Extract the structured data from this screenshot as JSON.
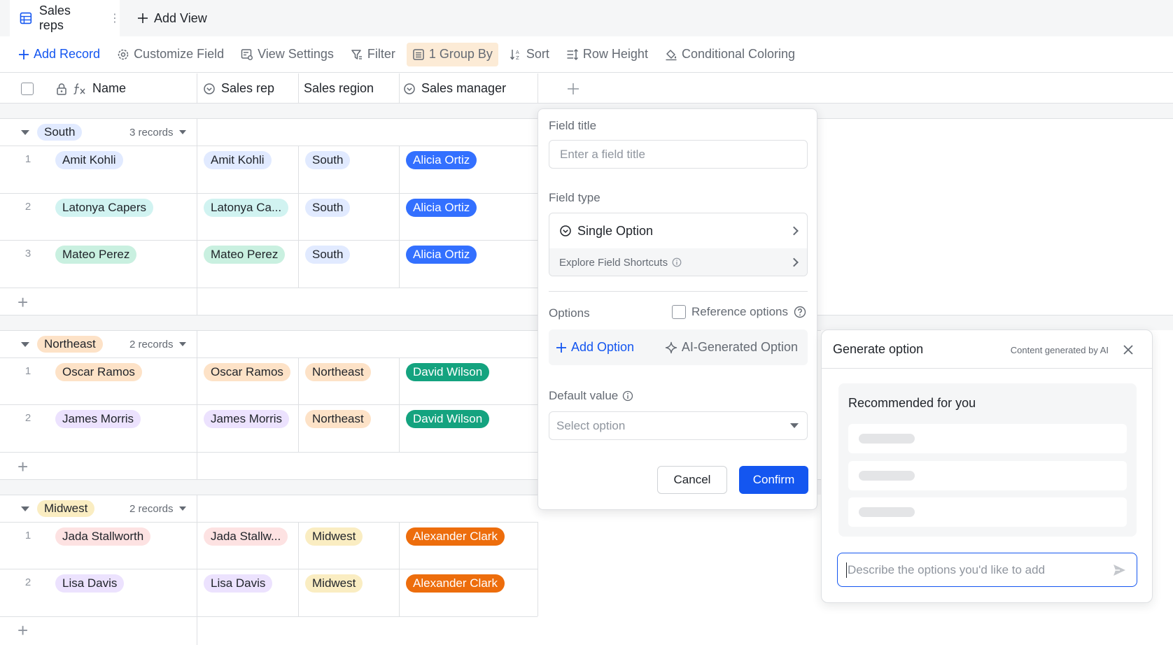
{
  "tabs": {
    "active_label": "Sales reps",
    "add_view_label": "Add View"
  },
  "toolbar": {
    "add_record": "Add Record",
    "customize_field": "Customize Field",
    "view_settings": "View Settings",
    "filter": "Filter",
    "group_by": "1 Group By",
    "sort": "Sort",
    "row_height": "Row Height",
    "conditional_coloring": "Conditional Coloring"
  },
  "columns": {
    "name": "Name",
    "sales_rep": "Sales rep",
    "sales_region": "Sales region",
    "sales_manager": "Sales manager"
  },
  "groups": [
    {
      "label": "South",
      "count": "3 records",
      "tag_color": "#e1eaff",
      "rows": [
        {
          "num": "1",
          "name": "Amit Kohli",
          "name_color": "#e1eaff",
          "rep": "Amit Kohli",
          "rep_color": "#e1eaff",
          "region": "South",
          "region_color": "#e1eaff",
          "manager": "Alicia Ortiz",
          "manager_color": "#3370ff"
        },
        {
          "num": "2",
          "name": "Latonya Capers",
          "name_color": "#d1f3f1",
          "rep": "Latonya Ca...",
          "rep_color": "#d1f3f1",
          "region": "South",
          "region_color": "#e1eaff",
          "manager": "Alicia Ortiz",
          "manager_color": "#3370ff"
        },
        {
          "num": "3",
          "name": "Mateo Perez",
          "name_color": "#c9f0e0",
          "rep": "Mateo Perez",
          "rep_color": "#c9f0e0",
          "region": "South",
          "region_color": "#e1eaff",
          "manager": "Alicia Ortiz",
          "manager_color": "#3370ff"
        }
      ]
    },
    {
      "label": "Northeast",
      "count": "2 records",
      "tag_color": "#fde2c7",
      "rows": [
        {
          "num": "1",
          "name": "Oscar Ramos",
          "name_color": "#fde2c7",
          "rep": "Oscar Ramos",
          "rep_color": "#fde2c7",
          "region": "Northeast",
          "region_color": "#fde2c7",
          "manager": "David Wilson",
          "manager_color": "#14a37f"
        },
        {
          "num": "2",
          "name": "James Morris",
          "name_color": "#ece2fe",
          "rep": "James Morris",
          "rep_color": "#ece2fe",
          "region": "Northeast",
          "region_color": "#fde2c7",
          "manager": "David Wilson",
          "manager_color": "#14a37f"
        }
      ]
    },
    {
      "label": "Midwest",
      "count": "2 records",
      "tag_color": "#faedc2",
      "rows": [
        {
          "num": "1",
          "name": "Jada Stallworth",
          "name_color": "#fde2e2",
          "rep": "Jada Stallw...",
          "rep_color": "#fde2e2",
          "region": "Midwest",
          "region_color": "#faedc2",
          "manager": "Alexander Clark",
          "manager_color": "#ed6d0c"
        },
        {
          "num": "2",
          "name": "Lisa Davis",
          "name_color": "#ece2fe",
          "rep": "Lisa Davis",
          "rep_color": "#ece2fe",
          "region": "Midwest",
          "region_color": "#faedc2",
          "manager": "Alexander Clark",
          "manager_color": "#ed6d0c"
        }
      ]
    }
  ],
  "field_panel": {
    "field_title_label": "Field title",
    "field_title_placeholder": "Enter a field title",
    "field_type_label": "Field type",
    "field_type_value": "Single Option",
    "explore_shortcuts": "Explore Field Shortcuts",
    "options_label": "Options",
    "reference_options": "Reference options",
    "add_option": "Add Option",
    "ai_option": "AI-Generated Option",
    "default_value_label": "Default value",
    "default_value_placeholder": "Select option",
    "cancel": "Cancel",
    "confirm": "Confirm"
  },
  "generate_panel": {
    "title": "Generate option",
    "note": "Content generated by AI",
    "recommended_title": "Recommended for you",
    "input_placeholder": "Describe the options you'd like to add"
  },
  "colors": {
    "accent": "#1456f0",
    "border": "#dee0e3",
    "muted_text": "#646a73"
  }
}
